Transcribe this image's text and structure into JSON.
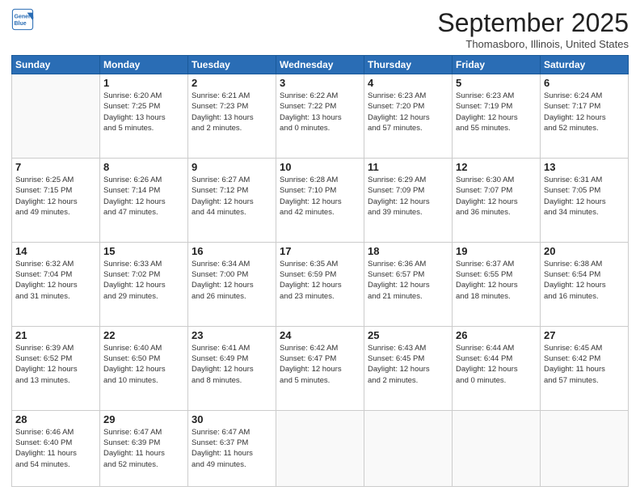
{
  "header": {
    "logo_line1": "General",
    "logo_line2": "Blue",
    "month": "September 2025",
    "location": "Thomasboro, Illinois, United States"
  },
  "weekdays": [
    "Sunday",
    "Monday",
    "Tuesday",
    "Wednesday",
    "Thursday",
    "Friday",
    "Saturday"
  ],
  "weeks": [
    [
      {
        "day": "",
        "info": ""
      },
      {
        "day": "1",
        "info": "Sunrise: 6:20 AM\nSunset: 7:25 PM\nDaylight: 13 hours\nand 5 minutes."
      },
      {
        "day": "2",
        "info": "Sunrise: 6:21 AM\nSunset: 7:23 PM\nDaylight: 13 hours\nand 2 minutes."
      },
      {
        "day": "3",
        "info": "Sunrise: 6:22 AM\nSunset: 7:22 PM\nDaylight: 13 hours\nand 0 minutes."
      },
      {
        "day": "4",
        "info": "Sunrise: 6:23 AM\nSunset: 7:20 PM\nDaylight: 12 hours\nand 57 minutes."
      },
      {
        "day": "5",
        "info": "Sunrise: 6:23 AM\nSunset: 7:19 PM\nDaylight: 12 hours\nand 55 minutes."
      },
      {
        "day": "6",
        "info": "Sunrise: 6:24 AM\nSunset: 7:17 PM\nDaylight: 12 hours\nand 52 minutes."
      }
    ],
    [
      {
        "day": "7",
        "info": "Sunrise: 6:25 AM\nSunset: 7:15 PM\nDaylight: 12 hours\nand 49 minutes."
      },
      {
        "day": "8",
        "info": "Sunrise: 6:26 AM\nSunset: 7:14 PM\nDaylight: 12 hours\nand 47 minutes."
      },
      {
        "day": "9",
        "info": "Sunrise: 6:27 AM\nSunset: 7:12 PM\nDaylight: 12 hours\nand 44 minutes."
      },
      {
        "day": "10",
        "info": "Sunrise: 6:28 AM\nSunset: 7:10 PM\nDaylight: 12 hours\nand 42 minutes."
      },
      {
        "day": "11",
        "info": "Sunrise: 6:29 AM\nSunset: 7:09 PM\nDaylight: 12 hours\nand 39 minutes."
      },
      {
        "day": "12",
        "info": "Sunrise: 6:30 AM\nSunset: 7:07 PM\nDaylight: 12 hours\nand 36 minutes."
      },
      {
        "day": "13",
        "info": "Sunrise: 6:31 AM\nSunset: 7:05 PM\nDaylight: 12 hours\nand 34 minutes."
      }
    ],
    [
      {
        "day": "14",
        "info": "Sunrise: 6:32 AM\nSunset: 7:04 PM\nDaylight: 12 hours\nand 31 minutes."
      },
      {
        "day": "15",
        "info": "Sunrise: 6:33 AM\nSunset: 7:02 PM\nDaylight: 12 hours\nand 29 minutes."
      },
      {
        "day": "16",
        "info": "Sunrise: 6:34 AM\nSunset: 7:00 PM\nDaylight: 12 hours\nand 26 minutes."
      },
      {
        "day": "17",
        "info": "Sunrise: 6:35 AM\nSunset: 6:59 PM\nDaylight: 12 hours\nand 23 minutes."
      },
      {
        "day": "18",
        "info": "Sunrise: 6:36 AM\nSunset: 6:57 PM\nDaylight: 12 hours\nand 21 minutes."
      },
      {
        "day": "19",
        "info": "Sunrise: 6:37 AM\nSunset: 6:55 PM\nDaylight: 12 hours\nand 18 minutes."
      },
      {
        "day": "20",
        "info": "Sunrise: 6:38 AM\nSunset: 6:54 PM\nDaylight: 12 hours\nand 16 minutes."
      }
    ],
    [
      {
        "day": "21",
        "info": "Sunrise: 6:39 AM\nSunset: 6:52 PM\nDaylight: 12 hours\nand 13 minutes."
      },
      {
        "day": "22",
        "info": "Sunrise: 6:40 AM\nSunset: 6:50 PM\nDaylight: 12 hours\nand 10 minutes."
      },
      {
        "day": "23",
        "info": "Sunrise: 6:41 AM\nSunset: 6:49 PM\nDaylight: 12 hours\nand 8 minutes."
      },
      {
        "day": "24",
        "info": "Sunrise: 6:42 AM\nSunset: 6:47 PM\nDaylight: 12 hours\nand 5 minutes."
      },
      {
        "day": "25",
        "info": "Sunrise: 6:43 AM\nSunset: 6:45 PM\nDaylight: 12 hours\nand 2 minutes."
      },
      {
        "day": "26",
        "info": "Sunrise: 6:44 AM\nSunset: 6:44 PM\nDaylight: 12 hours\nand 0 minutes."
      },
      {
        "day": "27",
        "info": "Sunrise: 6:45 AM\nSunset: 6:42 PM\nDaylight: 11 hours\nand 57 minutes."
      }
    ],
    [
      {
        "day": "28",
        "info": "Sunrise: 6:46 AM\nSunset: 6:40 PM\nDaylight: 11 hours\nand 54 minutes."
      },
      {
        "day": "29",
        "info": "Sunrise: 6:47 AM\nSunset: 6:39 PM\nDaylight: 11 hours\nand 52 minutes."
      },
      {
        "day": "30",
        "info": "Sunrise: 6:47 AM\nSunset: 6:37 PM\nDaylight: 11 hours\nand 49 minutes."
      },
      {
        "day": "",
        "info": ""
      },
      {
        "day": "",
        "info": ""
      },
      {
        "day": "",
        "info": ""
      },
      {
        "day": "",
        "info": ""
      }
    ]
  ]
}
